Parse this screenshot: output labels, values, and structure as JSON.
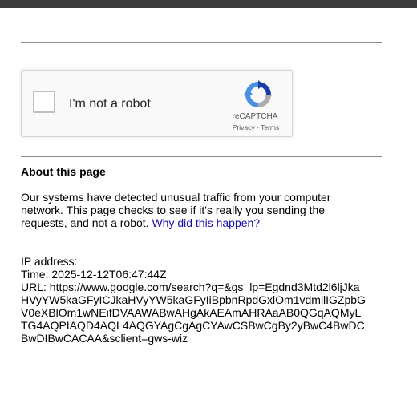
{
  "captcha": {
    "label": "I'm not a robot",
    "brand": "reCAPTCHA",
    "privacy_link": "Privacy",
    "separator": " - ",
    "terms_link": "Terms",
    "logo_icon": "recaptcha-logo-icon",
    "colors": {
      "blue": "#4a90e2",
      "dark_blue": "#1c3aa9",
      "gray": "#ababab"
    }
  },
  "about": {
    "heading": "About this page",
    "body": "Our systems have detected unusual traffic from your computer network. This page checks to see if it's really you sending the requests, and not a robot. ",
    "why_link": "Why did this happen?"
  },
  "meta": {
    "ip_label": "IP address:",
    "time_line": "Time: 2025-12-12T06:47:44Z",
    "url_lines": [
      "URL: https://www.google.com/search?q=&gs_lp=Egdnd3Mtd2l6ljJka",
      "HVyYW5kaGFyICJkaHVyYW5kaGFyIiBpbnRpdGxlOm1vdmllIGZpbG",
      "V0eXBlOm1wNEifDVAAWABwAHgAkAEAmAHRAaAB0QGqAQMyL",
      "TG4AQPIAQD4AQL4AQGYAgCgAgCYAwCSBwCgBy2yBwC4BwDC",
      "BwDIBwCACAA&sclient=gws-wiz"
    ]
  },
  "link_color": "#1a0dab"
}
